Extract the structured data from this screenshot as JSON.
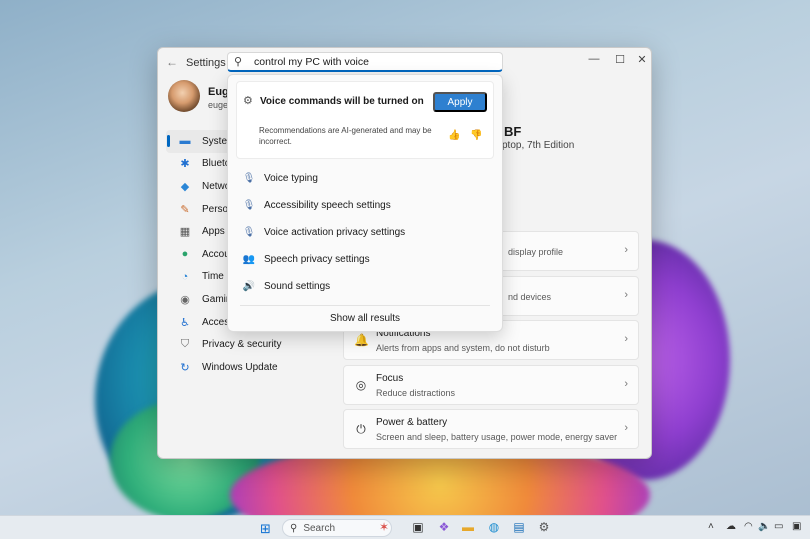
{
  "settings": {
    "title": "Settings",
    "user": {
      "name": "Euge",
      "email": "euge"
    },
    "nav": [
      {
        "label": "System",
        "icon": "▬",
        "color": "#2b7bd1"
      },
      {
        "label": "Bluetoo",
        "icon": "✱",
        "color": "#1f6fd0"
      },
      {
        "label": "Network",
        "icon": "◆",
        "color": "#2b86d6"
      },
      {
        "label": "Persona",
        "icon": "✎",
        "color": "#c96a2b"
      },
      {
        "label": "Apps",
        "icon": "▦",
        "color": "#555555"
      },
      {
        "label": "Accoun",
        "icon": "●",
        "color": "#2aa36b"
      },
      {
        "label": "Time &",
        "icon": "◔",
        "color": "#2b86d6"
      },
      {
        "label": "Gaming",
        "icon": "◉",
        "color": "#666666"
      },
      {
        "label": "Accessib",
        "icon": "♿",
        "color": "#1f6fd0"
      },
      {
        "label": "Privacy & security",
        "icon": "⛉",
        "color": "#6b6b6b"
      },
      {
        "label": "Windows Update",
        "icon": "↻",
        "color": "#1f6fd0"
      }
    ],
    "device": {
      "name": "BF",
      "model": "ptop, 7th Edition"
    },
    "cards": [
      {
        "title": "",
        "subtitle": "display profile",
        "icon": ""
      },
      {
        "title": "",
        "subtitle": "nd devices",
        "icon": ""
      },
      {
        "title": "Notifications",
        "subtitle": "Alerts from apps and system, do not disturb",
        "icon": "🔔"
      },
      {
        "title": "Focus",
        "subtitle": "Reduce distractions",
        "icon": "◎"
      },
      {
        "title": "Power & battery",
        "subtitle": "Screen and sleep, battery usage, power mode, energy saver",
        "icon": "⏻"
      }
    ]
  },
  "search": {
    "query": "control my PC with voice",
    "ai_card": {
      "title": "Voice commands will be turned on",
      "apply_label": "Apply",
      "disclaimer": "Recommendations are AI-generated and may be incorrect."
    },
    "results": [
      {
        "label": "Voice typing",
        "icon": "🎙"
      },
      {
        "label": "Accessibility speech settings",
        "icon": "🎙"
      },
      {
        "label": "Voice activation privacy settings",
        "icon": "🎙"
      },
      {
        "label": "Speech privacy settings",
        "icon": "👥"
      },
      {
        "label": "Sound settings",
        "icon": "🔊"
      }
    ],
    "show_all_label": "Show all results"
  },
  "taskbar": {
    "search_label": "Search"
  }
}
